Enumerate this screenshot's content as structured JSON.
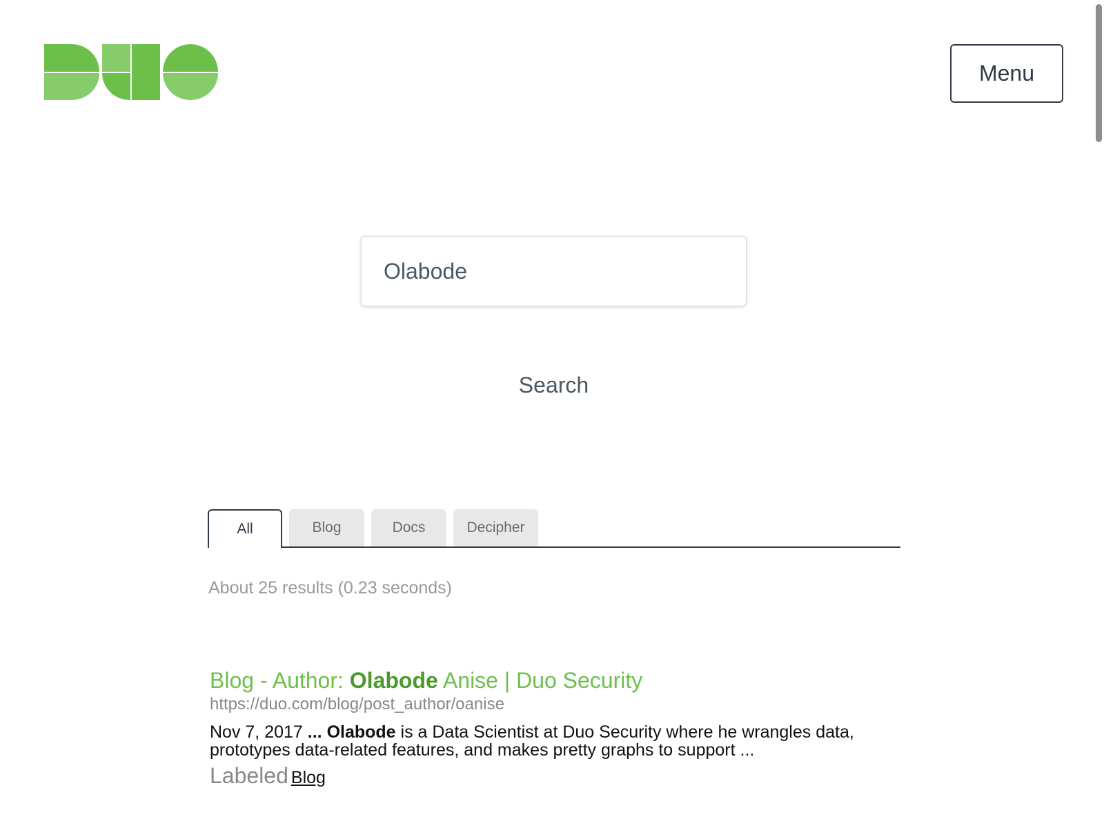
{
  "header": {
    "logo_alt": "Duo",
    "menu_label": "Menu"
  },
  "colors": {
    "brand_green": "#6cc04a",
    "brand_green_dark": "#4a9a2d",
    "text_dark": "#2e3a46"
  },
  "search": {
    "value": "Olabode",
    "button_label": "Search"
  },
  "tabs": [
    {
      "label": "All",
      "active": true
    },
    {
      "label": "Blog",
      "active": false
    },
    {
      "label": "Docs",
      "active": false
    },
    {
      "label": "Decipher",
      "active": false
    }
  ],
  "results": {
    "stats": "About 25 results (0.23 seconds)",
    "items": [
      {
        "title_prefix": "Blog - Author: ",
        "title_highlight": "Olabode",
        "title_suffix": " Anise | Duo Security",
        "url": "https://duo.com/blog/post_author/oanise",
        "snippet_date": "Nov 7, 2017 ",
        "snippet_ellipsis": "...",
        "snippet_highlight": "Olabode",
        "snippet_text": " is a Data Scientist at Duo Security where he wrangles data, prototypes data-related features, and makes pretty graphs to support ...",
        "labeled_text": "Labeled",
        "label": "Blog"
      }
    ]
  }
}
